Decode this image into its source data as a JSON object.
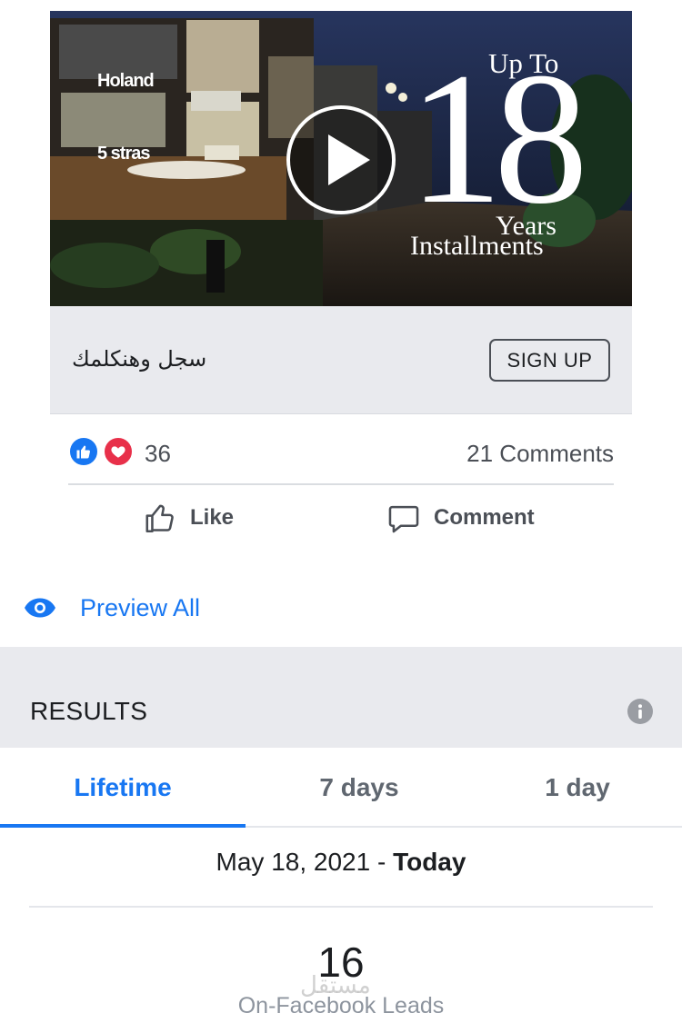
{
  "ad": {
    "media": {
      "overlay_top": "Up To",
      "overlay_number": "18",
      "overlay_years": "Years",
      "overlay_installments": "Installments",
      "storefront_signs": [
        "Holand",
        "5 stras"
      ],
      "icon": "play-icon"
    },
    "cta": {
      "headline": "سجل وهنكلمك",
      "button_label": "SIGN UP"
    }
  },
  "engagement": {
    "reaction_count": "36",
    "comments_label": "21 Comments",
    "reaction_icons": [
      "like-reaction-icon",
      "love-reaction-icon"
    ],
    "actions": {
      "like_label": "Like",
      "comment_label": "Comment"
    }
  },
  "preview": {
    "label": "Preview All",
    "icon": "eye-icon"
  },
  "results": {
    "title": "RESULTS",
    "tabs": [
      {
        "label": "Lifetime",
        "active": true
      },
      {
        "label": "7 days",
        "active": false
      },
      {
        "label": "1 day",
        "active": false
      }
    ],
    "date_start": "May 18, 2021 - ",
    "date_end": "Today",
    "metric_value": "16",
    "metric_label": "On-Facebook Leads"
  },
  "watermark": "مستقل",
  "colors": {
    "accent": "#1877f2",
    "love": "#e8304a",
    "panel_bg": "#e9eaee",
    "muted_text": "#606770"
  }
}
